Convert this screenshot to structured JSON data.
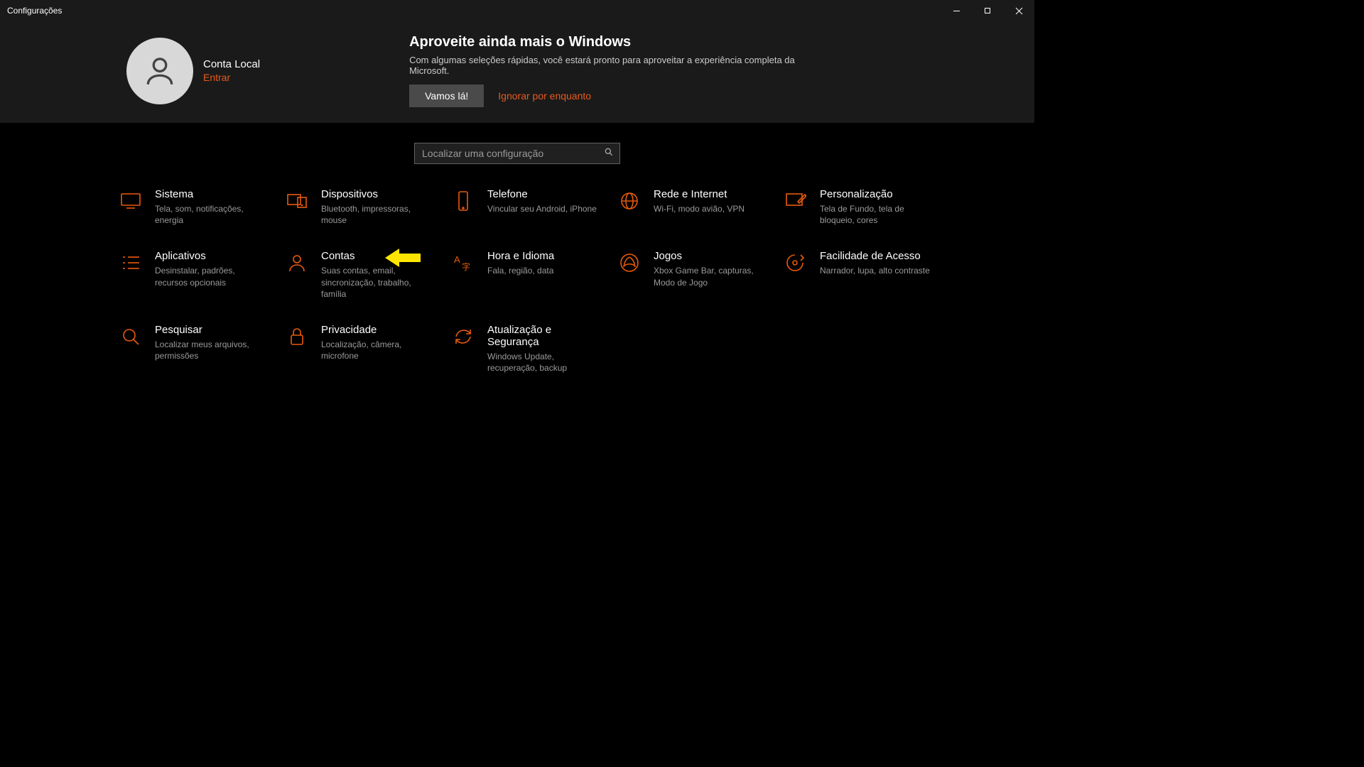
{
  "window": {
    "title": "Configurações"
  },
  "header": {
    "account_name": "Conta Local",
    "signin_label": "Entrar",
    "promo_title": "Aproveite ainda mais o Windows",
    "promo_text": "Com algumas seleções rápidas, você estará pronto para aproveitar a experiência completa da Microsoft.",
    "cta_primary": "Vamos lá!",
    "cta_secondary": "Ignorar por enquanto"
  },
  "search": {
    "placeholder": "Localizar uma configuração"
  },
  "sections": {
    "system": {
      "label": "Sistema",
      "desc": "Tela, som, notificações, energia"
    },
    "devices": {
      "label": "Dispositivos",
      "desc": "Bluetooth, impressoras, mouse"
    },
    "phone": {
      "label": "Telefone",
      "desc": "Vincular seu Android, iPhone"
    },
    "network": {
      "label": "Rede e Internet",
      "desc": "Wi-Fi, modo avião, VPN"
    },
    "personalization": {
      "label": "Personalização",
      "desc": "Tela de Fundo, tela de bloqueio, cores"
    },
    "apps": {
      "label": "Aplicativos",
      "desc": "Desinstalar, padrões, recursos opcionais"
    },
    "accounts": {
      "label": "Contas",
      "desc": "Suas contas, email, sincronização, trabalho, família"
    },
    "time": {
      "label": "Hora e Idioma",
      "desc": "Fala, região, data"
    },
    "gaming": {
      "label": "Jogos",
      "desc": "Xbox Game Bar, capturas, Modo de Jogo"
    },
    "ease": {
      "label": "Facilidade de Acesso",
      "desc": "Narrador, lupa, alto contraste"
    },
    "search_cat": {
      "label": "Pesquisar",
      "desc": "Localizar meus arquivos, permissões"
    },
    "privacy": {
      "label": "Privacidade",
      "desc": "Localização, câmera, microfone"
    },
    "update": {
      "label": "Atualização e Segurança",
      "desc": "Windows Update, recuperação, backup"
    }
  },
  "annotation": {
    "arrow_target": "accounts"
  }
}
